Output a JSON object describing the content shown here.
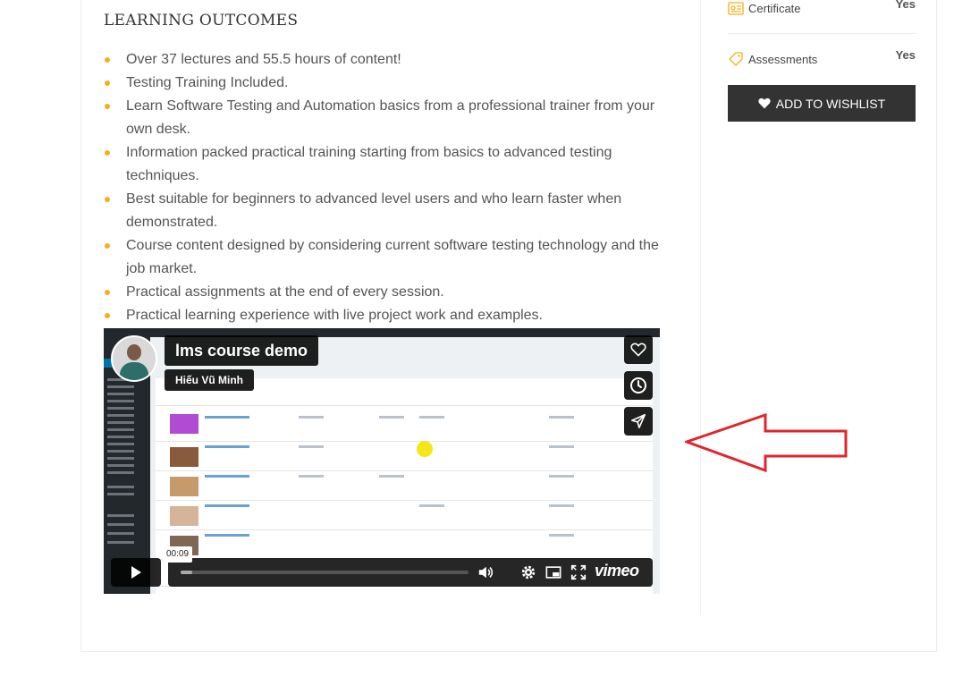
{
  "outcomes": {
    "title": "LEARNING OUTCOMES",
    "items": [
      "Over 37 lectures and 55.5 hours of content!",
      "Testing Training Included.",
      "Learn Software Testing and Automation basics from a professional trainer from your own desk.",
      "Information packed practical training starting from basics to advanced testing techniques.",
      "Best suitable for beginners to advanced level users and who learn faster when demonstrated.",
      "Course content designed by considering current software testing technology and the job market.",
      "Practical assignments at the end of every session.",
      "Practical learning experience with live project work and examples."
    ]
  },
  "sidebar": {
    "certificate": {
      "label": "Certificate",
      "value": "Yes",
      "icon": "certificate-icon"
    },
    "assessments": {
      "label": "Assessments",
      "value": "Yes",
      "icon": "assessment-tag-icon"
    },
    "wishlist_label": "ADD TO WISHLIST"
  },
  "video": {
    "title": "lms course demo",
    "author": "Hiếu Vũ Minh",
    "time": "00:09",
    "progress": 0.04,
    "brand": "vimeo",
    "side_buttons": [
      "like-heart-icon",
      "watch-later-clock-icon",
      "share-send-icon"
    ]
  },
  "colors": {
    "bullet": "#f2b01e",
    "button": "#333333",
    "annotation_arrow": "#e0262b"
  }
}
